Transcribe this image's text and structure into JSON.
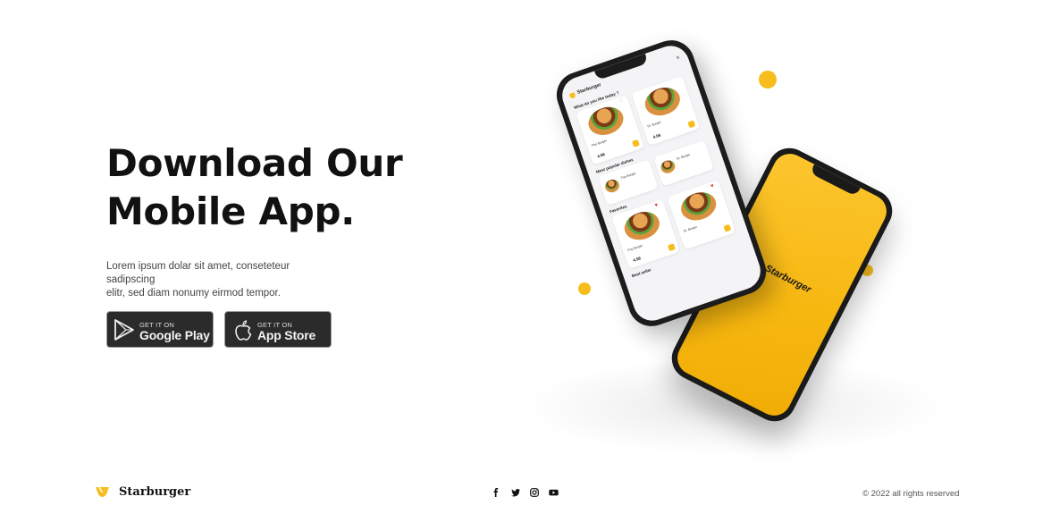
{
  "hero": {
    "title_line1": "Download Our",
    "title_line2": "Mobile App.",
    "description_line1": "Lorem ipsum dolar sit amet, conseteteur sadipscing",
    "description_line2": "elitr, sed diam nonumy eirmod tempor."
  },
  "store_buttons": {
    "google_play": {
      "small": "GET IT ON",
      "big": "Google Play",
      "icon": "google-play-icon"
    },
    "app_store": {
      "small": "GET IT ON",
      "big": "App Store",
      "icon": "apple-icon"
    }
  },
  "phone_front": {
    "app_name": "Starburger",
    "menu_icon": "menu-icon",
    "question": "What do you like today ?",
    "section_popular": "Most popular dishes",
    "section_favorites": "Favorites",
    "section_best": "Best seller",
    "cards": [
      {
        "name": "Pop Burger",
        "price": "4.58"
      },
      {
        "name": "Dr. Burger",
        "price": "4.06"
      },
      {
        "name": "Pop Burger",
        "price": ""
      },
      {
        "name": "Dr. Burger",
        "price": ""
      },
      {
        "name": "Pop Burger",
        "price": "4.58"
      },
      {
        "name": "Dr. Burger",
        "price": ""
      }
    ]
  },
  "phone_back": {
    "brand": "Starburger"
  },
  "footer": {
    "brand": "Starburger",
    "logo_icon": "starburger-logo-icon",
    "social": [
      "facebook-icon",
      "twitter-icon",
      "instagram-icon",
      "youtube-icon"
    ],
    "copyright": "© 2022 all rights reserved"
  },
  "colors": {
    "accent": "#f7bd1d",
    "text": "#111111",
    "store_button_bg": "#2b2b2b"
  }
}
